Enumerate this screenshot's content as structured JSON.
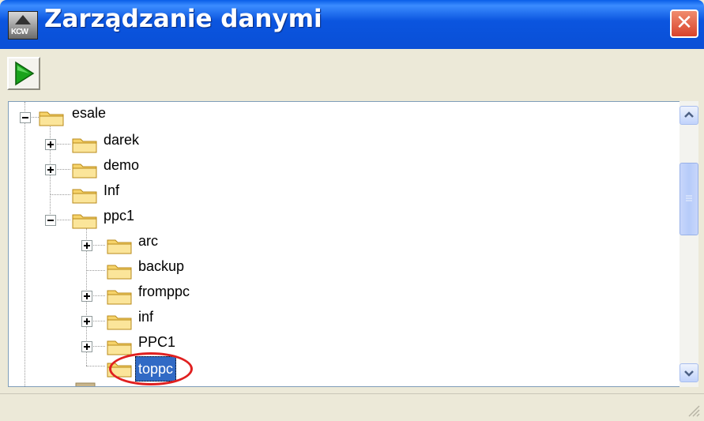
{
  "window": {
    "title": "Zarządzanie danymi",
    "app_icon_caption": "KCW"
  },
  "toolbar": {
    "run_icon": "play-icon"
  },
  "tree": {
    "nodes": [
      {
        "label": "esale",
        "expander": "minus",
        "depth": 0
      },
      {
        "label": "darek",
        "expander": "plus",
        "depth": 1
      },
      {
        "label": "demo",
        "expander": "plus",
        "depth": 1
      },
      {
        "label": "Inf",
        "expander": "none",
        "depth": 1
      },
      {
        "label": "ppc1",
        "expander": "minus",
        "depth": 1
      },
      {
        "label": "arc",
        "expander": "plus",
        "depth": 2
      },
      {
        "label": "backup",
        "expander": "none",
        "depth": 2
      },
      {
        "label": "fromppc",
        "expander": "plus",
        "depth": 2
      },
      {
        "label": "inf",
        "expander": "plus",
        "depth": 2
      },
      {
        "label": "PPC1",
        "expander": "plus",
        "depth": 2
      },
      {
        "label": "toppc",
        "expander": "none",
        "depth": 2,
        "selected": true
      }
    ]
  },
  "colors": {
    "titlebar": "#0a55df",
    "selection": "#316ac5",
    "highlight_ring": "#e02020",
    "window_bg": "#ece9d8"
  }
}
